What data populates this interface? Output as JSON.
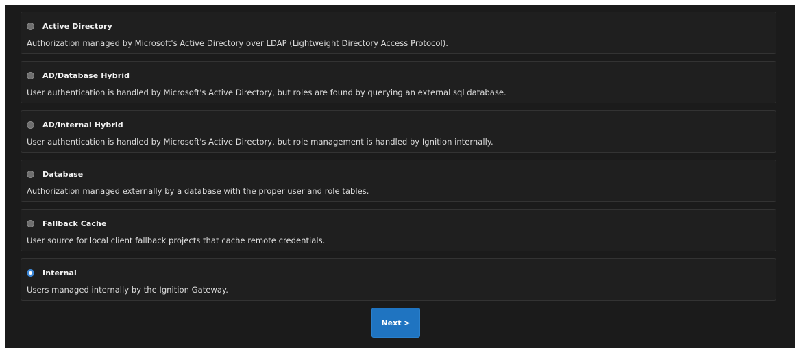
{
  "options": [
    {
      "title": "Active Directory",
      "description": "Authorization managed by Microsoft's Active Directory over LDAP (Lightweight Directory Access Protocol).",
      "selected": false
    },
    {
      "title": "AD/Database Hybrid",
      "description": "User authentication is handled by Microsoft's Active Directory, but roles are found by querying an external sql database.",
      "selected": false
    },
    {
      "title": "AD/Internal Hybrid",
      "description": "User authentication is handled by Microsoft's Active Directory, but role management is handled by Ignition internally.",
      "selected": false
    },
    {
      "title": "Database",
      "description": "Authorization managed externally by a database with the proper user and role tables.",
      "selected": false
    },
    {
      "title": "Fallback Cache",
      "description": "User source for local client fallback projects that cache remote credentials.",
      "selected": false
    },
    {
      "title": "Internal",
      "description": "Users managed internally by the Ignition Gateway.",
      "selected": true
    }
  ],
  "next_button": {
    "label": "Next >"
  },
  "colors": {
    "panel_background": "#1b1b1b",
    "option_background": "#1f1f1f",
    "option_border": "#333333",
    "accent": "#1f74c1",
    "radio_selected": "#3b86d6"
  }
}
